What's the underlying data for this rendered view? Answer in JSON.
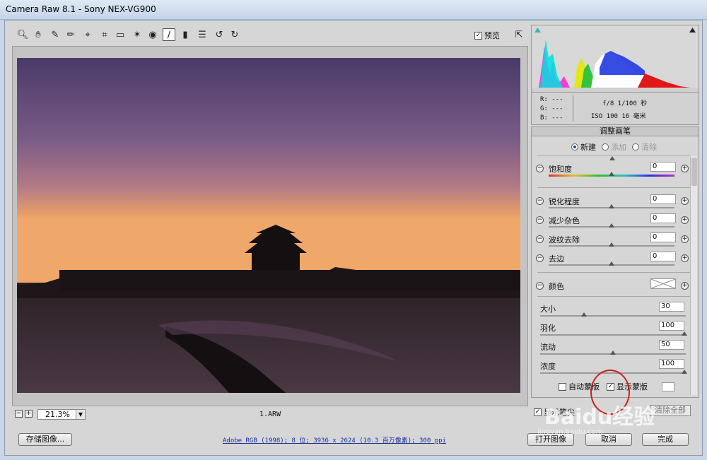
{
  "window": {
    "title": "Camera Raw 8.1 -  Sony NEX-VG900"
  },
  "toolbar": {
    "preview_label": "预览",
    "preview_checked": true,
    "tools": [
      "zoom-tool-icon",
      "hand-tool-icon",
      "white-balance-icon",
      "color-sampler-icon",
      "target-adjust-icon",
      "crop-icon",
      "straighten-icon",
      "spot-removal-icon",
      "red-eye-icon",
      "adjustment-brush-icon",
      "graduated-filter-icon",
      "radial-filter-icon",
      "preferences-icon",
      "rotate-left-icon",
      "rotate-right-icon"
    ]
  },
  "image": {
    "filename": "1.ARW"
  },
  "zoom": {
    "value": "21.3%"
  },
  "info": {
    "r": "R: ---",
    "g": "G: ---",
    "b": "B: ---",
    "exif_line1": "f/8  1/100 秒",
    "exif_line2": "ISO 100  16 毫米"
  },
  "panel": {
    "title": "调整画笔",
    "modes": [
      {
        "label": "新建",
        "selected": true,
        "enabled": true
      },
      {
        "label": "添加",
        "selected": false,
        "enabled": false
      },
      {
        "label": "清除",
        "selected": false,
        "enabled": false
      }
    ],
    "sliders": [
      {
        "label": "饱和度",
        "value": "0",
        "position": 0.5
      },
      {
        "label": "锐化程度",
        "value": "0",
        "position": 0.5
      },
      {
        "label": "减少杂色",
        "value": "0",
        "position": 0.5
      },
      {
        "label": "波纹去除",
        "value": "0",
        "position": 0.5
      },
      {
        "label": "去边",
        "value": "0",
        "position": 0.5
      }
    ],
    "color_label": "颜色",
    "brush": [
      {
        "label": "大小",
        "value": "30",
        "position": 0.3
      },
      {
        "label": "羽化",
        "value": "100",
        "position": 1.0
      },
      {
        "label": "流动",
        "value": "50",
        "position": 0.5
      },
      {
        "label": "浓度",
        "value": "100",
        "position": 1.0
      }
    ],
    "auto_mask": {
      "label": "自动蒙版",
      "checked": false
    },
    "show_mask": {
      "label": "显示蒙版",
      "checked": true
    },
    "show_pins": {
      "label": "显示笔尖",
      "checked": true
    },
    "clear_all": "清除全部"
  },
  "footer": {
    "save_label": "存储图像...",
    "workflow_link": "Adobe RGB (1998); 8 位; 3936 x 2624 (10.3 百万像素); 300 ppi",
    "open_label": "打开图像",
    "cancel_label": "取消",
    "done_label": "完成"
  },
  "watermark": {
    "brand": "Baidu经验",
    "url": "jingyan.baidu.com"
  }
}
